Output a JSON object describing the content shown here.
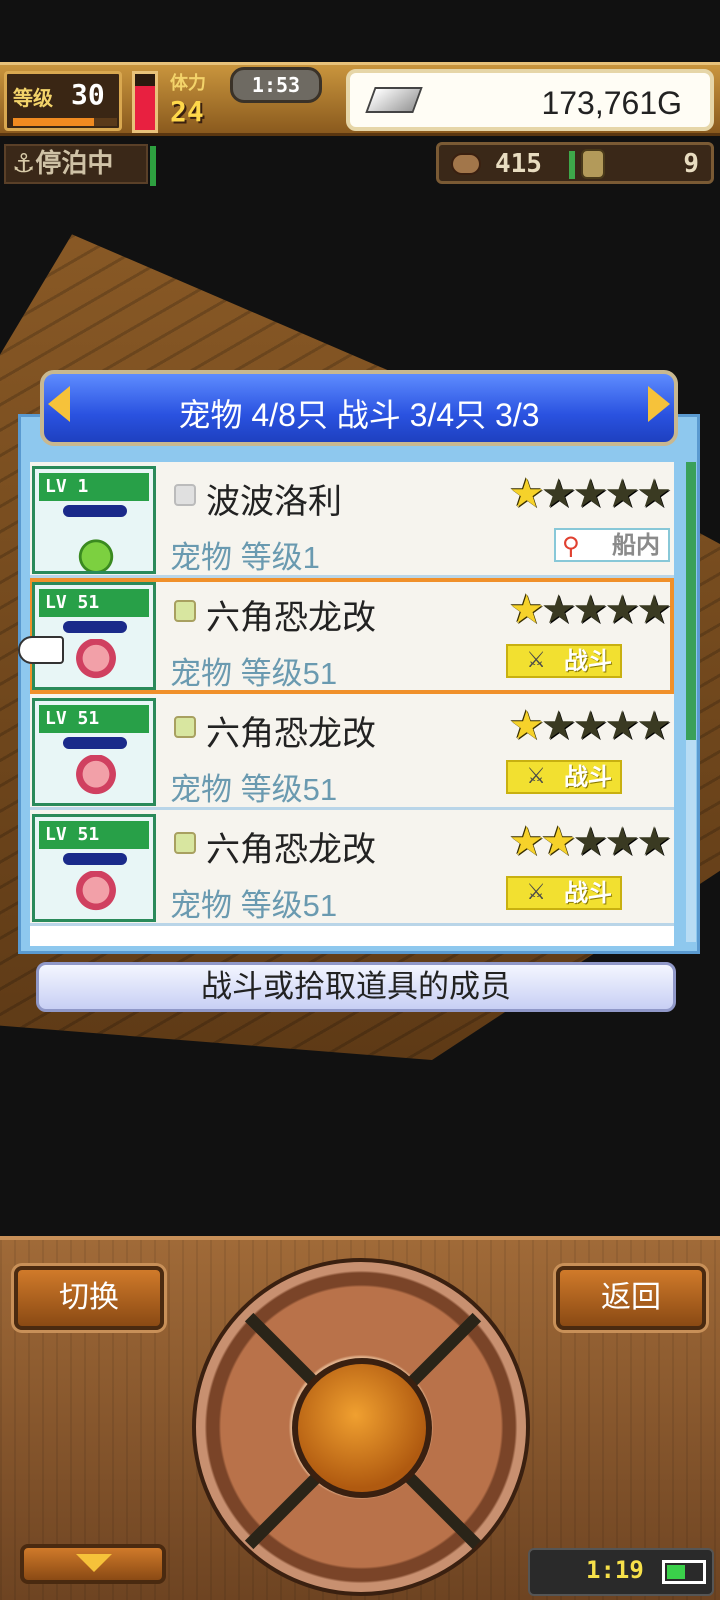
{
  "status_bar": {
    "level_label": "等级",
    "level_value": "30",
    "exp_fill_pct": 78,
    "stamina_fill_pct": 78,
    "stamina_label": "体力",
    "stamina_value": "24",
    "clock": "1:53",
    "money": "173,761G"
  },
  "sub_bar": {
    "anchor_text": "停泊中",
    "stat_1_value": "415",
    "stat_2_value": "9"
  },
  "panel": {
    "title": "宠物 4/8只 战斗 3/4只  3/3",
    "scroll_thumb_pct": 58,
    "hint": "战斗或拾取道具的成员",
    "pets": [
      {
        "avatar_level": "LV  1",
        "name": "波波洛利",
        "level_text": "宠物 等级1",
        "stars_on": 1,
        "badge_type": "location",
        "badge_text": "船内"
      },
      {
        "avatar_level": "LV 51",
        "name": "六角恐龙改",
        "level_text": "宠物 等级51",
        "stars_on": 1,
        "badge_type": "battle",
        "badge_text": "战斗"
      },
      {
        "avatar_level": "LV 51",
        "name": "六角恐龙改",
        "level_text": "宠物 等级51",
        "stars_on": 1,
        "badge_type": "battle",
        "badge_text": "战斗"
      },
      {
        "avatar_level": "LV 51",
        "name": "六角恐龙改",
        "level_text": "宠物 等级51",
        "stars_on": 2,
        "badge_type": "battle",
        "badge_text": "战斗"
      }
    ]
  },
  "controls": {
    "switch_label": "切换",
    "back_label": "返回"
  },
  "device": {
    "time": "1:19",
    "battery_pct": 50
  }
}
